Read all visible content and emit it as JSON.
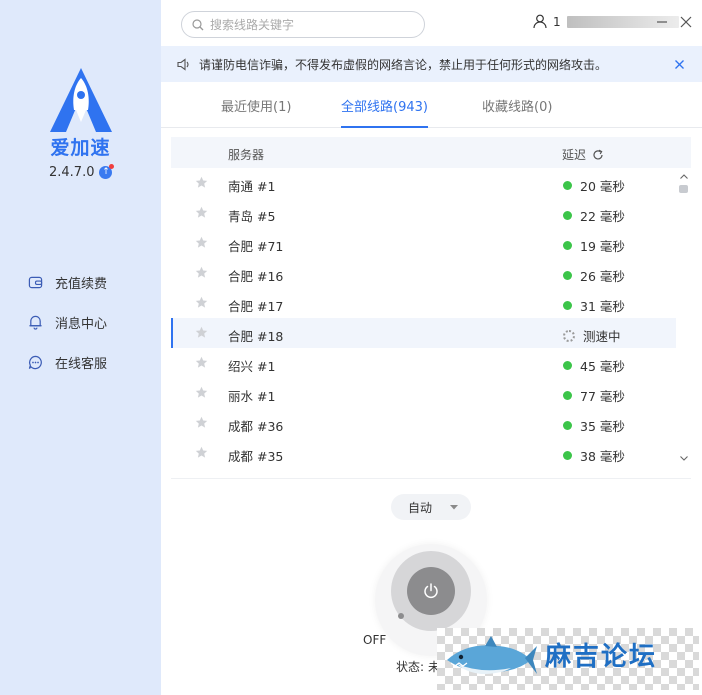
{
  "app": {
    "name": "爱加速",
    "version": "2.4.7.0"
  },
  "sidebar": {
    "items": [
      {
        "label": "充值续费",
        "icon": "wallet-icon"
      },
      {
        "label": "消息中心",
        "icon": "bell-icon"
      },
      {
        "label": "在线客服",
        "icon": "chat-icon"
      }
    ]
  },
  "search": {
    "placeholder": "搜索线路关键字",
    "value": ""
  },
  "user": {
    "initial": "1"
  },
  "notice": {
    "text": "请谨防电信诈骗，不得发布虚假的网络言论，禁止用于任何形式的网络攻击。"
  },
  "tabs": [
    {
      "label": "最近使用(1)"
    },
    {
      "label": "全部线路(943)"
    },
    {
      "label": "收藏线路(0)"
    }
  ],
  "list": {
    "header_server": "服务器",
    "header_latency": "延迟",
    "rows": [
      {
        "server": "南通  #1",
        "latency": "20 毫秒"
      },
      {
        "server": "青岛  #5",
        "latency": "22 毫秒"
      },
      {
        "server": "合肥  #71",
        "latency": "19 毫秒"
      },
      {
        "server": "合肥  #16",
        "latency": "26 毫秒"
      },
      {
        "server": "合肥  #17",
        "latency": "31 毫秒"
      },
      {
        "server": "合肥  #18",
        "latency": "测速中"
      },
      {
        "server": "绍兴  #1",
        "latency": "45 毫秒"
      },
      {
        "server": "丽水  #1",
        "latency": "77 毫秒"
      },
      {
        "server": "成都  #36",
        "latency": "35 毫秒"
      },
      {
        "server": "成都  #35",
        "latency": "38 毫秒"
      }
    ]
  },
  "control": {
    "mode": "自动",
    "power_state": "OFF",
    "status_label": "状态:",
    "status_value": "未"
  },
  "watermark": {
    "text": "麻吉论坛"
  },
  "colors": {
    "accent": "#2f73f0",
    "sidebar_bg": "#dfe9fb",
    "online_dot": "#3cc54a"
  }
}
